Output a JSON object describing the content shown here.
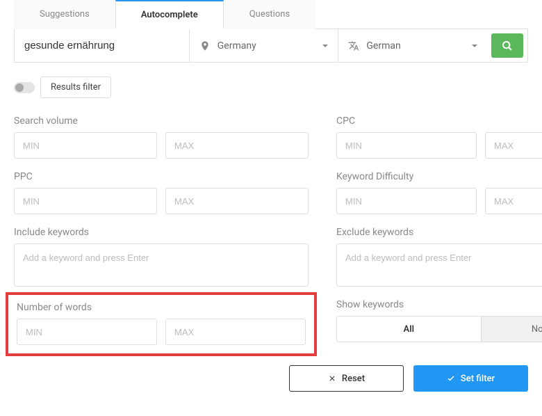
{
  "tabs": {
    "suggestions": "Suggestions",
    "autocomplete": "Autocomplete",
    "questions": "Questions"
  },
  "search": {
    "value": "gesunde ernährung",
    "country": "Germany",
    "language": "German"
  },
  "resultsFilter": {
    "label": "Results filter"
  },
  "filters": {
    "searchVolume": {
      "label": "Search volume",
      "min": "MIN",
      "max": "MAX"
    },
    "cpc": {
      "label": "CPC",
      "min": "MIN",
      "max": "MAX"
    },
    "ppc": {
      "label": "PPC",
      "min": "MIN",
      "max": "MAX"
    },
    "kd": {
      "label": "Keyword Difficulty",
      "min": "MIN",
      "max": "MAX"
    },
    "include": {
      "label": "Include keywords",
      "placeholder": "Add a keyword and press Enter"
    },
    "exclude": {
      "label": "Exclude keywords",
      "placeholder": "Add a keyword and press Enter"
    },
    "numWords": {
      "label": "Number of words",
      "min": "MIN",
      "max": "MAX"
    },
    "showKw": {
      "label": "Show keywords",
      "all": "All",
      "notInLists": "Not in lists"
    }
  },
  "buttons": {
    "reset": "Reset",
    "setFilter": "Set filter"
  }
}
